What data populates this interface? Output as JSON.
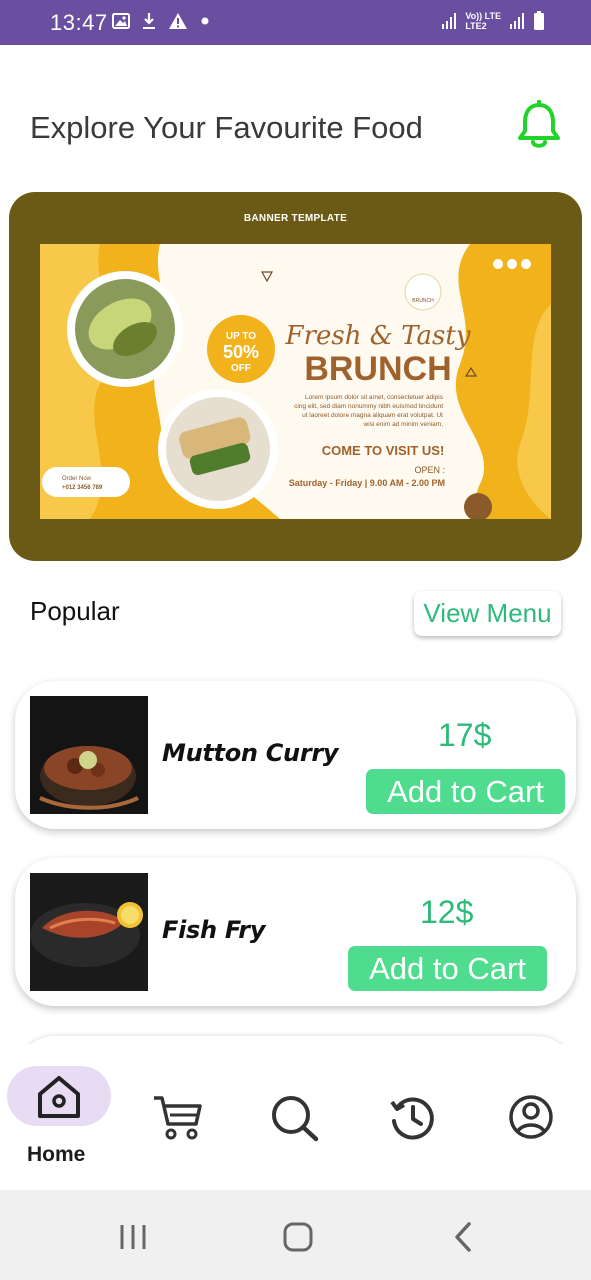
{
  "status_bar": {
    "time": "13:47",
    "icons_left": [
      "gallery-icon",
      "download-icon",
      "warning-icon",
      "dot-icon"
    ],
    "network_label_top": "Vo)) LTE",
    "network_label_bottom": "LTE2",
    "icons_right": [
      "signal-icon",
      "signal-icon",
      "battery-icon"
    ],
    "background_color": "#6a4ea0"
  },
  "header": {
    "title": "Explore Your Favourite Food",
    "bell_icon": "bell-icon",
    "bell_color": "#22d32a"
  },
  "banner": {
    "caption": "BANNER TEMPLATE",
    "frame_color": "#6b5a15",
    "image": {
      "discount_top": "UP TO",
      "discount_value": "50%",
      "discount_bottom": "OFF",
      "headline_script": "Fresh & Tasty",
      "headline": "BRUNCH",
      "body": "Lorem ipsum dolor sit amet, consectetuer adipis cing elit, sed diam nonummy nibh euismod tincidunt ut laoreet dolore magna aliquam erat volutpat. Ut wisi enim ad minim veniam,",
      "cta": "COME TO VISIT US!",
      "open_label": "OPEN :",
      "hours": "Saturday - Friday | 9.00 AM - 2.00 PM",
      "order_label": "Order Now",
      "order_phone": "+012 3456 789",
      "logo_text": "BRUNCH"
    }
  },
  "popular": {
    "title": "Popular",
    "view_menu_label": "View Menu",
    "items": [
      {
        "name": "Mutton Curry",
        "price": "17$",
        "button": "Add to Cart"
      },
      {
        "name": "Fish Fry",
        "price": "12$",
        "button": "Add to Cart"
      }
    ]
  },
  "bottom_nav": {
    "items": [
      {
        "icon": "home-icon",
        "label": "Home",
        "active": true
      },
      {
        "icon": "cart-icon",
        "label": "",
        "active": false
      },
      {
        "icon": "search-icon",
        "label": "",
        "active": false
      },
      {
        "icon": "history-icon",
        "label": "",
        "active": false
      },
      {
        "icon": "profile-icon",
        "label": "",
        "active": false
      }
    ],
    "active_pill_color": "#e8dcf5"
  },
  "system_nav": {
    "buttons": [
      "recents-icon",
      "home-circle-icon",
      "back-icon"
    ]
  },
  "colors": {
    "accent_green": "#2fb97b",
    "button_green": "#4fdc8f"
  }
}
